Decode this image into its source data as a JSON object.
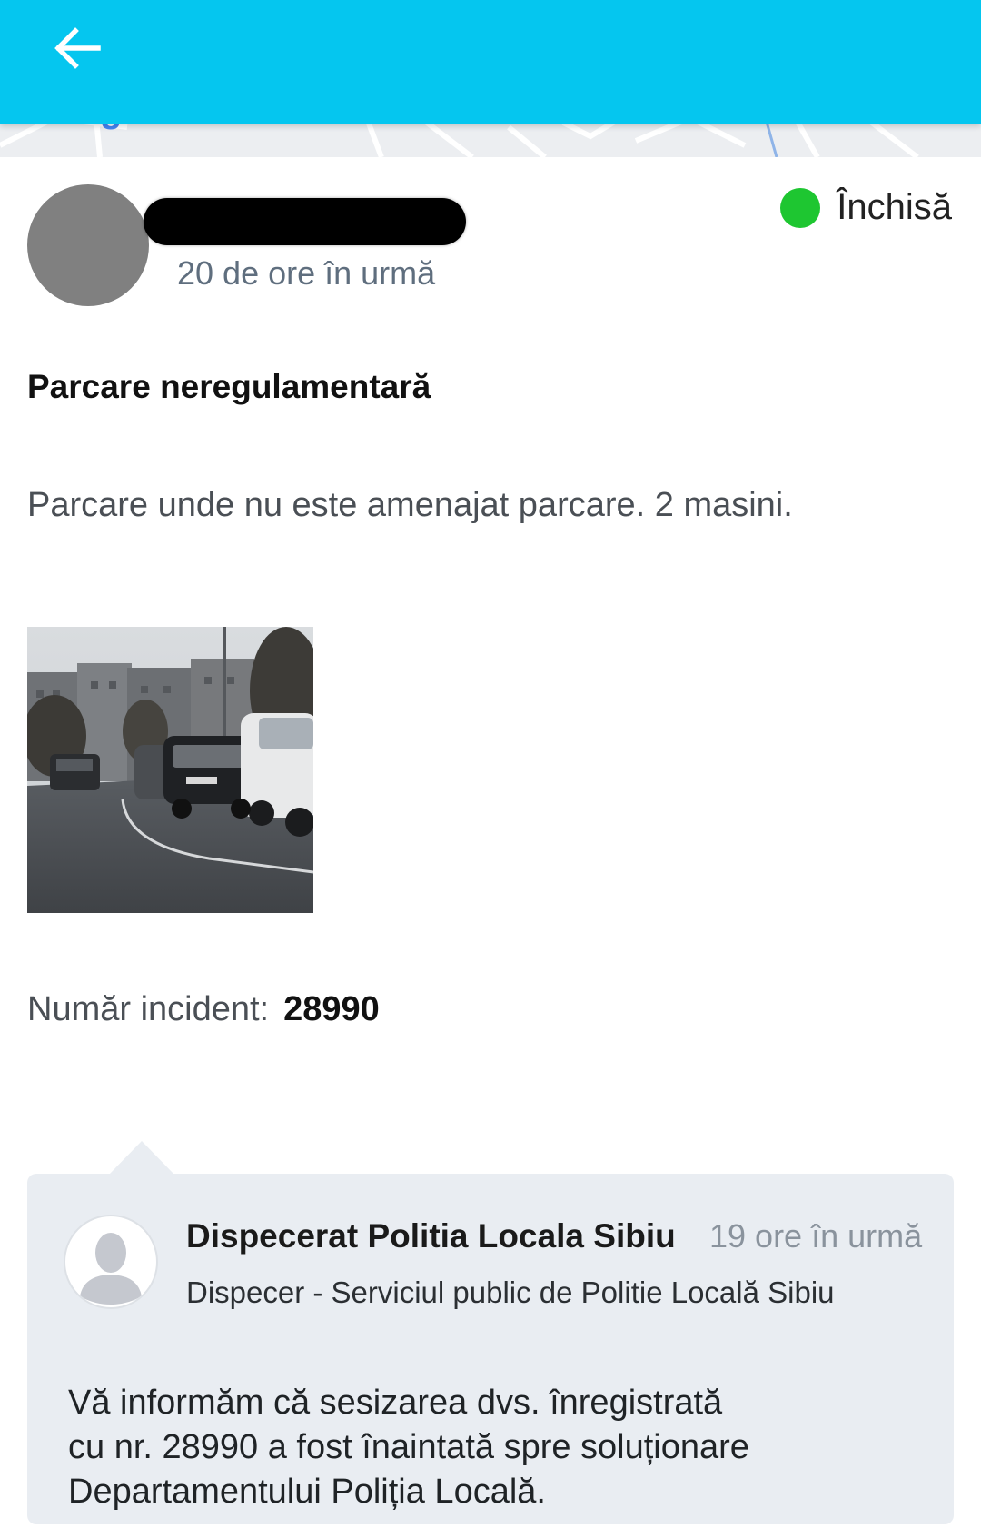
{
  "app_bar": {
    "back_icon": "arrow-left-icon",
    "color": "#05c6ef"
  },
  "map": {
    "partial_logo_text": "Google"
  },
  "report": {
    "author_name": "",
    "time_ago": "20 de ore în urmă",
    "status_label": "Închisă",
    "status_color": "#1ec631",
    "title": "Parcare neregulamentară",
    "description": "Parcare unde nu este amenajat parcare. 2 masini.",
    "incident_number_label": "Număr incident:",
    "incident_number": "28990"
  },
  "reply": {
    "author": "Dispecerat Politia Locala Sibiu",
    "time_ago": "19 ore în urmă",
    "role": "Dispecer - Serviciul public de Politie Locală Sibiu",
    "message_lines": [
      "Vă informăm că sesizarea dvs. înregistrată",
      "cu nr. 28990 a fost înaintată spre soluționare",
      "Departamentului Poliția Locală."
    ],
    "avatar_icon": "user-placeholder-icon"
  }
}
